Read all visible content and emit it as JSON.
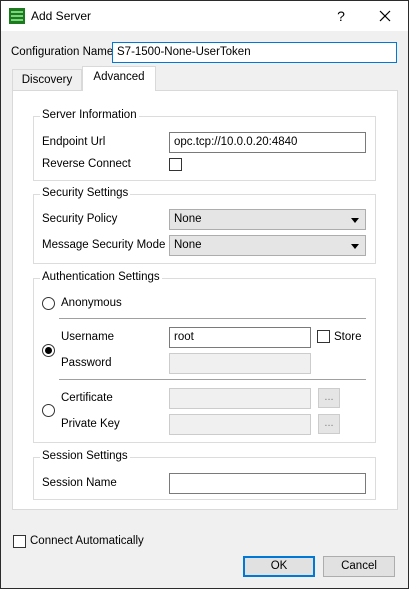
{
  "window": {
    "title": "Add Server",
    "help_glyph": "?"
  },
  "config_name": {
    "label": "Configuration Name",
    "value": "S7-1500-None-UserToken"
  },
  "tabs": [
    {
      "label": "Discovery"
    },
    {
      "label": "Advanced"
    }
  ],
  "server_info": {
    "title": "Server Information",
    "endpoint_label": "Endpoint Url",
    "endpoint_value": "opc.tcp://10.0.0.20:4840",
    "reverse_connect_label": "Reverse Connect"
  },
  "security": {
    "title": "Security Settings",
    "policy_label": "Security Policy",
    "policy_value": "None",
    "mode_label": "Message Security Mode",
    "mode_value": "None"
  },
  "auth": {
    "title": "Authentication Settings",
    "anonymous_label": "Anonymous",
    "username_label": "Username",
    "username_value": "root",
    "store_label": "Store",
    "password_label": "Password",
    "certificate_label": "Certificate",
    "private_key_label": "Private Key",
    "browse_label": "..."
  },
  "session": {
    "title": "Session Settings",
    "name_label": "Session Name",
    "name_value": ""
  },
  "connect_auto_label": "Connect Automatically",
  "buttons": {
    "ok": "OK",
    "cancel": "Cancel"
  }
}
